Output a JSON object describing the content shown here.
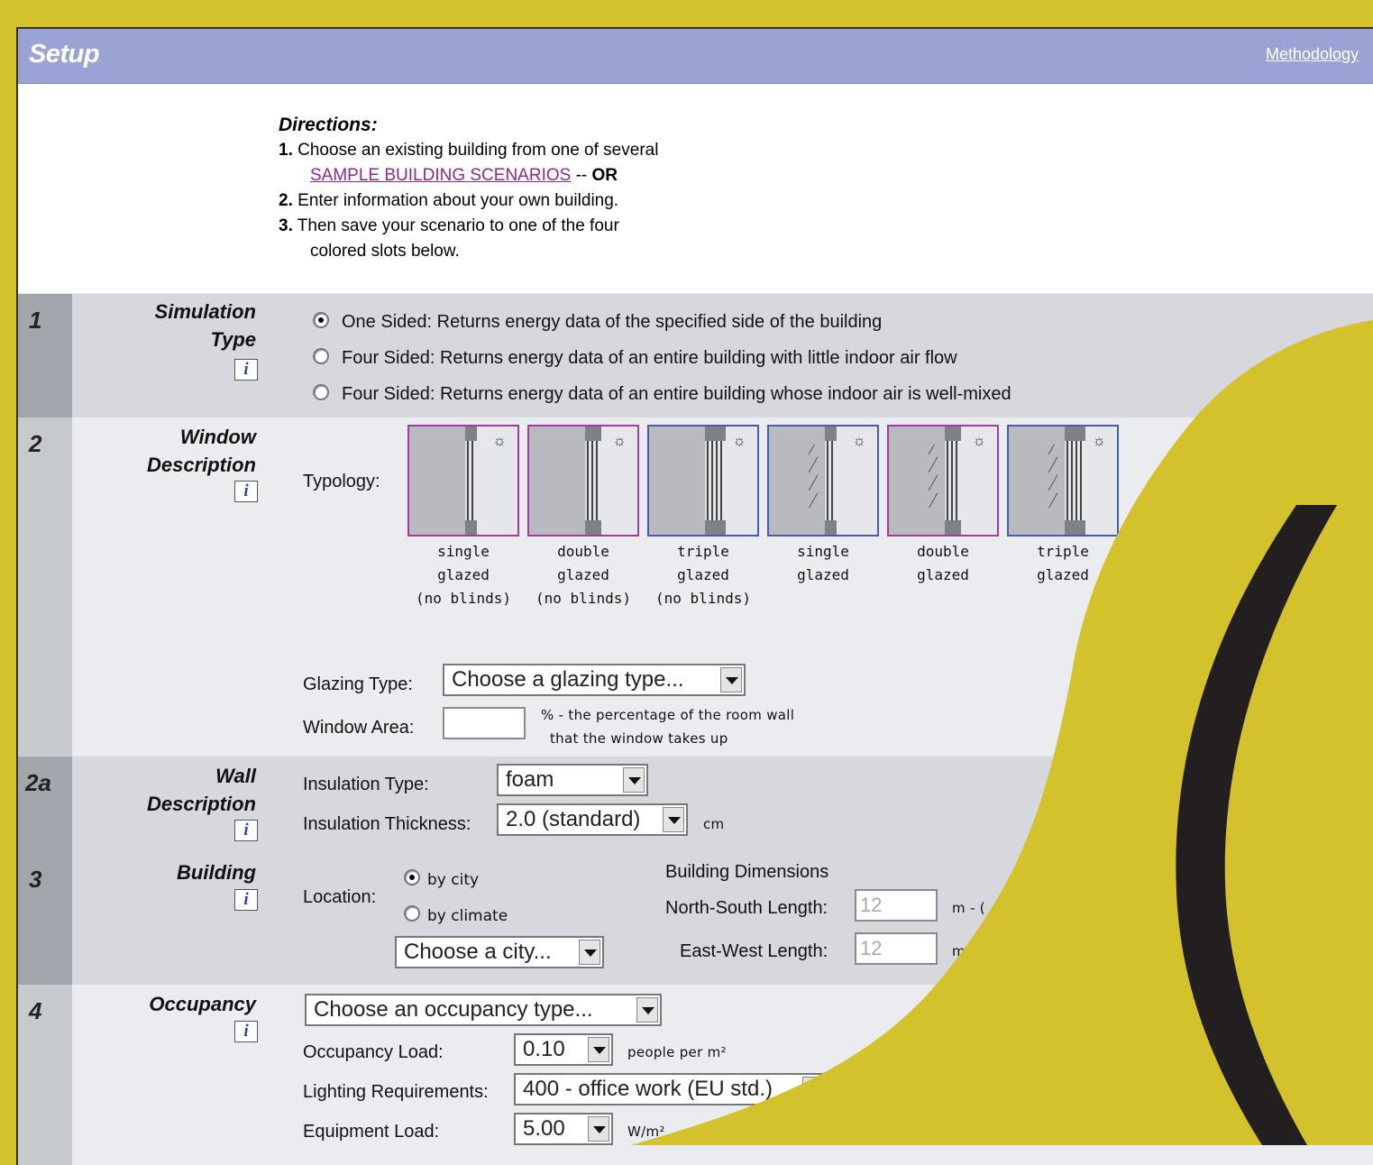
{
  "header": {
    "title": "Setup",
    "methodology_link": "Methodology"
  },
  "directions": {
    "title": "Directions:",
    "steps": [
      {
        "num": "1.",
        "text": "Choose an existing building from one of several"
      },
      {
        "link": "SAMPLE BUILDING SCENARIOS",
        "suffix": " -- ",
        "or": "OR"
      },
      {
        "num": "2.",
        "text": "Enter information about your own building."
      },
      {
        "num": "3.",
        "text": "Then save your scenario to one of the four"
      },
      {
        "text": "colored slots below."
      }
    ]
  },
  "section1": {
    "num": "1",
    "label_line1": "Simulation",
    "label_line2": "Type",
    "info": "i",
    "options": [
      {
        "label": "One Sided: Returns energy data of the specified side of the building",
        "selected": true
      },
      {
        "label": "Four Sided: Returns energy data of an entire building with little indoor air flow",
        "selected": false
      },
      {
        "label": "Four Sided: Returns energy data of an entire building whose indoor air is well-mixed",
        "selected": false
      }
    ]
  },
  "section2": {
    "num": "2",
    "label_line1": "Window",
    "label_line2": "Description",
    "info": "i",
    "typology_label": "Typology:",
    "typologies": [
      {
        "line1": "single",
        "line2": "glazed",
        "line3": "(no blinds)",
        "border": "purple"
      },
      {
        "line1": "double",
        "line2": "glazed",
        "line3": "(no blinds)",
        "border": "purple"
      },
      {
        "line1": "triple",
        "line2": "glazed",
        "line3": "(no blinds)",
        "border": "blue"
      },
      {
        "line1": "single",
        "line2": "glazed",
        "line3": "",
        "border": "blue"
      },
      {
        "line1": "double",
        "line2": "glazed",
        "line3": "",
        "border": "purple"
      },
      {
        "line1": "triple",
        "line2": "glazed",
        "line3": "",
        "border": "blue"
      }
    ],
    "glazing_label": "Glazing Type:",
    "glazing_value": "Choose a glazing type...",
    "window_area_label": "Window Area:",
    "window_area_value": "",
    "window_area_note1": "% - the percentage of the room wall",
    "window_area_note2": "that the window takes up"
  },
  "section2a": {
    "num": "2a",
    "label_line1": "Wall",
    "label_line2": "Description",
    "info": "i",
    "insulation_type_label": "Insulation Type:",
    "insulation_type_value": "foam",
    "insulation_thickness_label": "Insulation Thickness:",
    "insulation_thickness_value": "2.0 (standard)",
    "thickness_unit": "cm"
  },
  "section3": {
    "num": "3",
    "label_line1": "Building",
    "info": "i",
    "location_label": "Location:",
    "by_city": "by city",
    "by_climate": "by climate",
    "city_value": "Choose a city...",
    "dimensions_title": "Building Dimensions",
    "ns_label": "North-South Length:",
    "ns_value": "12",
    "ns_unit": "m - (",
    "ew_label": "East-West Length:",
    "ew_value": "12",
    "ew_unit": "m"
  },
  "section4": {
    "num": "4",
    "label_line1": "Occupancy",
    "info": "i",
    "occupancy_value": "Choose an occupancy type...",
    "load_label": "Occupancy Load:",
    "load_value": "0.10",
    "load_unit": "people per m²",
    "lighting_label": "Lighting Requirements:",
    "lighting_value": "400 - office work (EU std.)",
    "equipment_label": "Equipment Load:",
    "equipment_value": "5.00",
    "equipment_unit": "W/m²"
  },
  "colors": {
    "background": "#d4c22c",
    "header_bar": "#9aa3d3",
    "overlay_stroke": "#231f20",
    "link_purple": "#8a2a8c"
  }
}
